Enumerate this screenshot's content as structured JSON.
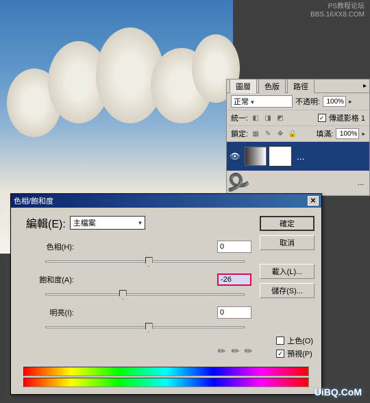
{
  "watermark": {
    "top_line1": "PS教程论坛",
    "top_line2": "BBS.16XX8.COM",
    "bottom": "UiBQ.CoM"
  },
  "layers_panel": {
    "tabs": {
      "layers": "圖層",
      "channels": "色版",
      "paths": "路徑"
    },
    "blend_mode": "正常",
    "opacity_label": "不透明:",
    "opacity_value": "100%",
    "unify_label": "統一:",
    "propagate_label": "傳遞影格 1",
    "lock_label": "鎖定:",
    "fill_label": "填滿:",
    "fill_value": "100%"
  },
  "dialog": {
    "title": "色相/飽和度",
    "edit_label": "編輯(E):",
    "edit_value": "主檔案",
    "hue_label": "色相(H):",
    "hue_value": "0",
    "saturation_label": "飽和度(A):",
    "saturation_value": "-26",
    "lightness_label": "明亮(I):",
    "lightness_value": "0",
    "buttons": {
      "ok": "確定",
      "cancel": "取消",
      "load": "載入(L)...",
      "save": "儲存(S)..."
    },
    "colorize_label": "上色(O)",
    "preview_label": "預視(P)"
  }
}
